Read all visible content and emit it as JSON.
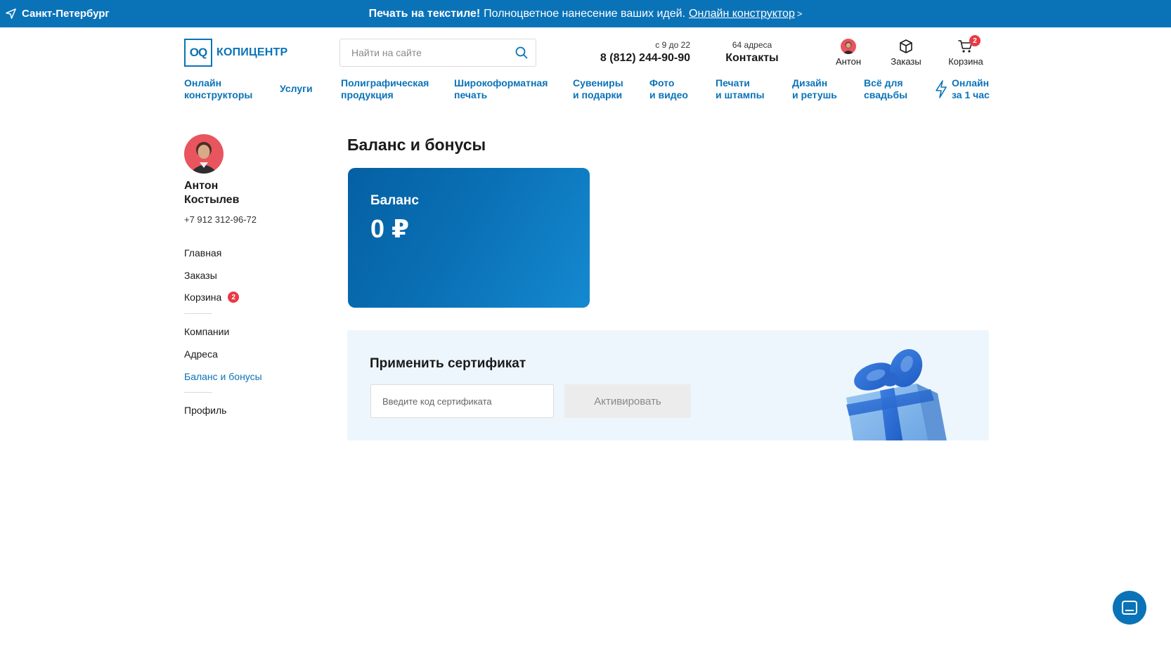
{
  "topbar": {
    "city": "Санкт-Петербург",
    "promo_bold": "Печать на текстиле!",
    "promo_text": "Полноцветное нанесение ваших идей.",
    "promo_link": "Онлайн конструктор",
    "promo_chevron": ">"
  },
  "header": {
    "logo_mark": "OQ",
    "logo_text": "КОПИЦЕНТР",
    "search_placeholder": "Найти на сайте",
    "hours": "с 9 до 22",
    "phone": "8 (812) 244-90-90",
    "addresses": "64 адреса",
    "contacts": "Контакты",
    "user_label": "Антон",
    "orders_label": "Заказы",
    "cart_label": "Корзина",
    "cart_count": "2"
  },
  "nav": {
    "items": [
      {
        "line1": "Онлайн",
        "line2": "конструкторы"
      },
      {
        "line1": "Услуги",
        "line2": ""
      },
      {
        "line1": "Полиграфическая",
        "line2": "продукция"
      },
      {
        "line1": "Широкоформатная",
        "line2": "печать"
      },
      {
        "line1": "Сувениры",
        "line2": "и подарки"
      },
      {
        "line1": "Фото",
        "line2": "и видео"
      },
      {
        "line1": "Печати",
        "line2": "и штампы"
      },
      {
        "line1": "Дизайн",
        "line2": "и ретушь"
      },
      {
        "line1": "Всё для",
        "line2": "свадьбы"
      },
      {
        "line1": "Онлайн",
        "line2": "за 1 час"
      }
    ]
  },
  "sidebar": {
    "first_name": "Антон",
    "last_name": "Костылев",
    "phone": "+7 912 312-96-72",
    "items": [
      {
        "label": "Главная"
      },
      {
        "label": "Заказы"
      },
      {
        "label": "Корзина",
        "badge": "2"
      },
      {
        "label": "Компании"
      },
      {
        "label": "Адреса"
      },
      {
        "label": "Баланс и бонусы",
        "active": true
      },
      {
        "label": "Профиль"
      }
    ]
  },
  "main": {
    "title": "Баланс и бонусы",
    "balance_label": "Баланс",
    "balance_value": "0 ₽",
    "cert_title": "Применить сертификат",
    "cert_placeholder": "Введите код сертификата",
    "cert_button": "Активировать"
  },
  "colors": {
    "brand": "#0a73b8",
    "badge": "#e83a44",
    "cert_bg": "#edf6fd"
  }
}
